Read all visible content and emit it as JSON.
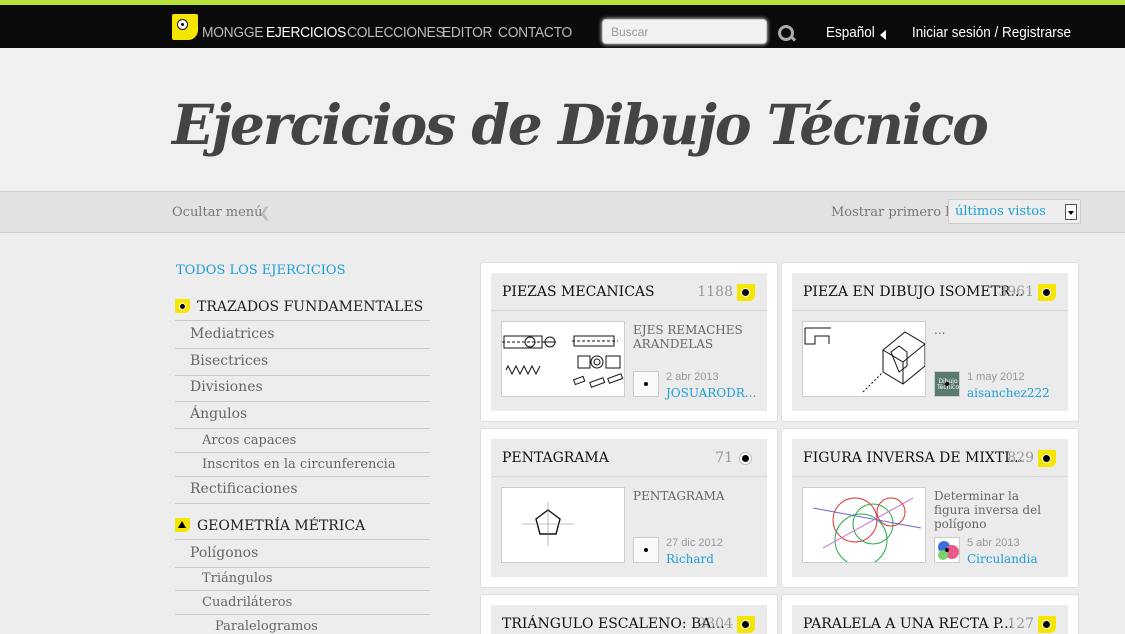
{
  "topbar": {
    "nav": [
      "MONGGE",
      "EJERCICIOS",
      "COLECCIONES",
      "EDITOR",
      "CONTACTO"
    ],
    "active_nav": "EJERCICIOS",
    "search_placeholder": "Buscar",
    "language": "Español",
    "login": "Iniciar sesión / Registrarse"
  },
  "header": {
    "title": "Ejercicios de Dibujo Técnico"
  },
  "subbar": {
    "hide_menu": "Ocultar menú",
    "show_first_label": "Mostrar primero los",
    "show_first_value": "últimos vistos"
  },
  "sidebar": {
    "all": "TODOS LOS EJERCICIOS",
    "cat1": "TRAZADOS FUNDAMENTALES",
    "cat1_items": [
      "Mediatrices",
      "Bisectrices",
      "Divisiones",
      "Ángulos"
    ],
    "cat1_sub": [
      "Arcos capaces",
      "Inscritos en la circunferencia"
    ],
    "cat1_last": "Rectificaciones",
    "cat2": "GEOMETRÍA MÉTRICA",
    "cat2_items": [
      "Polígonos"
    ],
    "cat2_sub": [
      "Triángulos",
      "Cuadriláteros"
    ],
    "cat2_subsub": [
      "Paralelogramos"
    ]
  },
  "cards": [
    {
      "title": "PIEZAS MECANICAS",
      "count": "1188",
      "desc": "EJES REMACHES ARANDELAS",
      "date": "2 abr 2013",
      "user": "JOSUARODR...",
      "badge": "yellow"
    },
    {
      "title": "PIEZA EN DIBUJO ISOMETR...",
      "count": "3961",
      "desc": "...",
      "date": "1 may 2012",
      "user": "aisanchez222",
      "badge": "yellow",
      "avatar_text": "Dibujo Técnico"
    },
    {
      "title": "PENTAGRAMA",
      "count": "71",
      "desc": "PENTAGRAMA",
      "date": "27 dic 2012",
      "user": "Richard",
      "badge": "plain"
    },
    {
      "title": "FIGURA INVERSA DE MIXTI...",
      "count": "829",
      "desc": "Determinar la figura inversa del polígono",
      "date": "5 abr 2013",
      "user": "Circulandia",
      "badge": "yellow"
    },
    {
      "title": "TRIÁNGULO ESCALENO: BA...",
      "count": "2304",
      "badge": "yellow"
    },
    {
      "title": "PARALELA A UNA RECTA P...",
      "count": "127",
      "badge": "yellow"
    }
  ]
}
